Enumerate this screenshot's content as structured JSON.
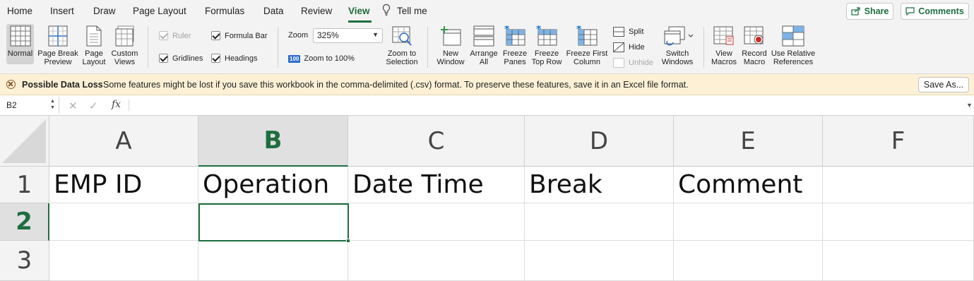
{
  "menu": {
    "tabs": [
      "Home",
      "Insert",
      "Draw",
      "Page Layout",
      "Formulas",
      "Data",
      "Review",
      "View"
    ],
    "active_tab": "View",
    "tell_me": "Tell me",
    "share": "Share",
    "comments": "Comments"
  },
  "ribbon": {
    "normal": "Normal",
    "page_break_preview": [
      "Page Break",
      "Preview"
    ],
    "page_layout": [
      "Page",
      "Layout"
    ],
    "custom_views": [
      "Custom",
      "Views"
    ],
    "ruler": "Ruler",
    "formula_bar": "Formula Bar",
    "gridlines": "Gridlines",
    "headings": "Headings",
    "zoom_label": "Zoom",
    "zoom_value": "325%",
    "zoom_100_badge": "100",
    "zoom_to_100": "Zoom to 100%",
    "zoom_to_selection": [
      "Zoom to",
      "Selection"
    ],
    "new_window": [
      "New",
      "Window"
    ],
    "arrange_all": [
      "Arrange",
      "All"
    ],
    "freeze_panes": [
      "Freeze",
      "Panes"
    ],
    "freeze_top_row": [
      "Freeze",
      "Top Row"
    ],
    "freeze_first_column": [
      "Freeze First",
      "Column"
    ],
    "split": "Split",
    "hide": "Hide",
    "unhide": "Unhide",
    "switch_windows": [
      "Switch",
      "Windows"
    ],
    "view_macros": [
      "View",
      "Macros"
    ],
    "record_macro": [
      "Record",
      "Macro"
    ],
    "use_relative_references": [
      "Use Relative",
      "References"
    ]
  },
  "notice": {
    "title": "Possible Data Loss",
    "message": "Some features might be lost if you save this workbook in the comma-delimited (.csv) format. To preserve these features, save it in an Excel file format.",
    "save_as": "Save As..."
  },
  "formula_bar": {
    "name_box": "B2",
    "fx": "fx",
    "value": ""
  },
  "sheet": {
    "columns": [
      "A",
      "B",
      "C",
      "D",
      "E",
      "F"
    ],
    "rows": [
      "1",
      "2",
      "3"
    ],
    "selected_column": "B",
    "selected_row": "2",
    "cells": [
      [
        "EMP ID",
        "Operation",
        "Date Time",
        "Break",
        "Comment",
        ""
      ],
      [
        "",
        "",
        "",
        "",
        "",
        ""
      ],
      [
        "",
        "",
        "",
        "",
        "",
        ""
      ]
    ]
  },
  "colors": {
    "accent": "#1e6e3e",
    "notice_bg": "#fdf0d5",
    "ribbon_bg": "#f3f3f3"
  }
}
